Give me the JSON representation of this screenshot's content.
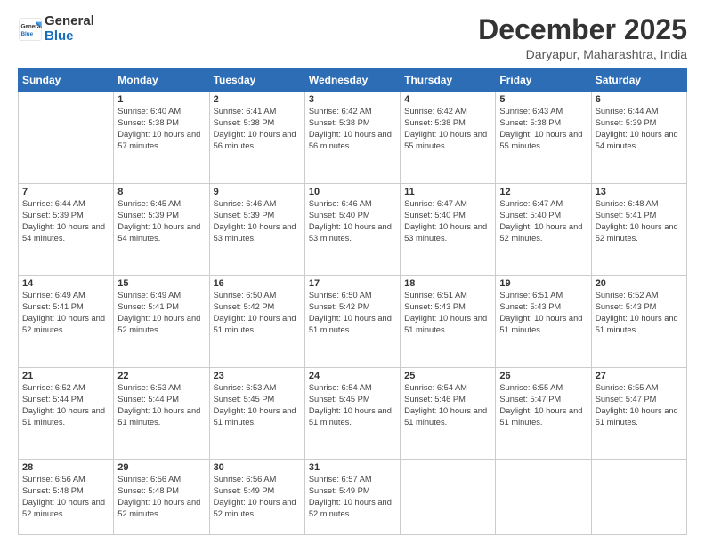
{
  "logo": {
    "line1": "General",
    "line2": "Blue"
  },
  "header": {
    "month": "December 2025",
    "location": "Daryapur, Maharashtra, India"
  },
  "weekdays": [
    "Sunday",
    "Monday",
    "Tuesday",
    "Wednesday",
    "Thursday",
    "Friday",
    "Saturday"
  ],
  "weeks": [
    [
      {
        "day": "",
        "sunrise": "",
        "sunset": "",
        "daylight": ""
      },
      {
        "day": "1",
        "sunrise": "Sunrise: 6:40 AM",
        "sunset": "Sunset: 5:38 PM",
        "daylight": "Daylight: 10 hours and 57 minutes."
      },
      {
        "day": "2",
        "sunrise": "Sunrise: 6:41 AM",
        "sunset": "Sunset: 5:38 PM",
        "daylight": "Daylight: 10 hours and 56 minutes."
      },
      {
        "day": "3",
        "sunrise": "Sunrise: 6:42 AM",
        "sunset": "Sunset: 5:38 PM",
        "daylight": "Daylight: 10 hours and 56 minutes."
      },
      {
        "day": "4",
        "sunrise": "Sunrise: 6:42 AM",
        "sunset": "Sunset: 5:38 PM",
        "daylight": "Daylight: 10 hours and 55 minutes."
      },
      {
        "day": "5",
        "sunrise": "Sunrise: 6:43 AM",
        "sunset": "Sunset: 5:38 PM",
        "daylight": "Daylight: 10 hours and 55 minutes."
      },
      {
        "day": "6",
        "sunrise": "Sunrise: 6:44 AM",
        "sunset": "Sunset: 5:39 PM",
        "daylight": "Daylight: 10 hours and 54 minutes."
      }
    ],
    [
      {
        "day": "7",
        "sunrise": "Sunrise: 6:44 AM",
        "sunset": "Sunset: 5:39 PM",
        "daylight": "Daylight: 10 hours and 54 minutes."
      },
      {
        "day": "8",
        "sunrise": "Sunrise: 6:45 AM",
        "sunset": "Sunset: 5:39 PM",
        "daylight": "Daylight: 10 hours and 54 minutes."
      },
      {
        "day": "9",
        "sunrise": "Sunrise: 6:46 AM",
        "sunset": "Sunset: 5:39 PM",
        "daylight": "Daylight: 10 hours and 53 minutes."
      },
      {
        "day": "10",
        "sunrise": "Sunrise: 6:46 AM",
        "sunset": "Sunset: 5:40 PM",
        "daylight": "Daylight: 10 hours and 53 minutes."
      },
      {
        "day": "11",
        "sunrise": "Sunrise: 6:47 AM",
        "sunset": "Sunset: 5:40 PM",
        "daylight": "Daylight: 10 hours and 53 minutes."
      },
      {
        "day": "12",
        "sunrise": "Sunrise: 6:47 AM",
        "sunset": "Sunset: 5:40 PM",
        "daylight": "Daylight: 10 hours and 52 minutes."
      },
      {
        "day": "13",
        "sunrise": "Sunrise: 6:48 AM",
        "sunset": "Sunset: 5:41 PM",
        "daylight": "Daylight: 10 hours and 52 minutes."
      }
    ],
    [
      {
        "day": "14",
        "sunrise": "Sunrise: 6:49 AM",
        "sunset": "Sunset: 5:41 PM",
        "daylight": "Daylight: 10 hours and 52 minutes."
      },
      {
        "day": "15",
        "sunrise": "Sunrise: 6:49 AM",
        "sunset": "Sunset: 5:41 PM",
        "daylight": "Daylight: 10 hours and 52 minutes."
      },
      {
        "day": "16",
        "sunrise": "Sunrise: 6:50 AM",
        "sunset": "Sunset: 5:42 PM",
        "daylight": "Daylight: 10 hours and 51 minutes."
      },
      {
        "day": "17",
        "sunrise": "Sunrise: 6:50 AM",
        "sunset": "Sunset: 5:42 PM",
        "daylight": "Daylight: 10 hours and 51 minutes."
      },
      {
        "day": "18",
        "sunrise": "Sunrise: 6:51 AM",
        "sunset": "Sunset: 5:43 PM",
        "daylight": "Daylight: 10 hours and 51 minutes."
      },
      {
        "day": "19",
        "sunrise": "Sunrise: 6:51 AM",
        "sunset": "Sunset: 5:43 PM",
        "daylight": "Daylight: 10 hours and 51 minutes."
      },
      {
        "day": "20",
        "sunrise": "Sunrise: 6:52 AM",
        "sunset": "Sunset: 5:43 PM",
        "daylight": "Daylight: 10 hours and 51 minutes."
      }
    ],
    [
      {
        "day": "21",
        "sunrise": "Sunrise: 6:52 AM",
        "sunset": "Sunset: 5:44 PM",
        "daylight": "Daylight: 10 hours and 51 minutes."
      },
      {
        "day": "22",
        "sunrise": "Sunrise: 6:53 AM",
        "sunset": "Sunset: 5:44 PM",
        "daylight": "Daylight: 10 hours and 51 minutes."
      },
      {
        "day": "23",
        "sunrise": "Sunrise: 6:53 AM",
        "sunset": "Sunset: 5:45 PM",
        "daylight": "Daylight: 10 hours and 51 minutes."
      },
      {
        "day": "24",
        "sunrise": "Sunrise: 6:54 AM",
        "sunset": "Sunset: 5:45 PM",
        "daylight": "Daylight: 10 hours and 51 minutes."
      },
      {
        "day": "25",
        "sunrise": "Sunrise: 6:54 AM",
        "sunset": "Sunset: 5:46 PM",
        "daylight": "Daylight: 10 hours and 51 minutes."
      },
      {
        "day": "26",
        "sunrise": "Sunrise: 6:55 AM",
        "sunset": "Sunset: 5:47 PM",
        "daylight": "Daylight: 10 hours and 51 minutes."
      },
      {
        "day": "27",
        "sunrise": "Sunrise: 6:55 AM",
        "sunset": "Sunset: 5:47 PM",
        "daylight": "Daylight: 10 hours and 51 minutes."
      }
    ],
    [
      {
        "day": "28",
        "sunrise": "Sunrise: 6:56 AM",
        "sunset": "Sunset: 5:48 PM",
        "daylight": "Daylight: 10 hours and 52 minutes."
      },
      {
        "day": "29",
        "sunrise": "Sunrise: 6:56 AM",
        "sunset": "Sunset: 5:48 PM",
        "daylight": "Daylight: 10 hours and 52 minutes."
      },
      {
        "day": "30",
        "sunrise": "Sunrise: 6:56 AM",
        "sunset": "Sunset: 5:49 PM",
        "daylight": "Daylight: 10 hours and 52 minutes."
      },
      {
        "day": "31",
        "sunrise": "Sunrise: 6:57 AM",
        "sunset": "Sunset: 5:49 PM",
        "daylight": "Daylight: 10 hours and 52 minutes."
      },
      {
        "day": "",
        "sunrise": "",
        "sunset": "",
        "daylight": ""
      },
      {
        "day": "",
        "sunrise": "",
        "sunset": "",
        "daylight": ""
      },
      {
        "day": "",
        "sunrise": "",
        "sunset": "",
        "daylight": ""
      }
    ]
  ]
}
